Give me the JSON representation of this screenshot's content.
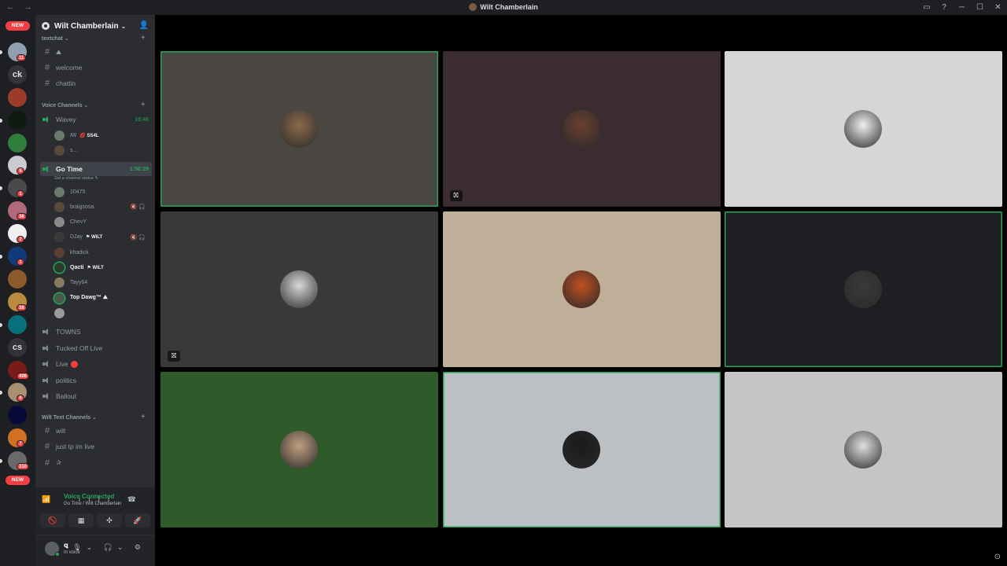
{
  "window": {
    "title": "Wilt Chamberlain",
    "nav_glyph": "← →",
    "controls": {
      "inbox": "▭",
      "help": "?",
      "minimize": "─",
      "maximize": "☐",
      "close": "✕"
    }
  },
  "guilds": {
    "items": [
      {
        "type": "new",
        "label": "NEW"
      },
      {
        "type": "icon",
        "color": "#8fa0b0",
        "badge": "11"
      },
      {
        "type": "text",
        "label": "ck"
      },
      {
        "type": "icon",
        "color": "#9a3b2b"
      },
      {
        "type": "icon",
        "color": "#0f1a12"
      },
      {
        "type": "icon",
        "color": "#2f7d3a"
      },
      {
        "type": "icon",
        "color": "#c9cbd0",
        "badge": "5"
      },
      {
        "type": "icon",
        "color": "#4a4a4a",
        "badge": "1"
      },
      {
        "type": "icon",
        "color": "#b06a7a",
        "badge": "38"
      },
      {
        "type": "icon",
        "color": "#f0f0f0",
        "badge": "2"
      },
      {
        "type": "icon",
        "color": "#123a7a",
        "badge": "1"
      },
      {
        "type": "icon",
        "color": "#8a5a2a"
      },
      {
        "type": "icon",
        "color": "#b98a40",
        "badge": "38"
      },
      {
        "type": "icon",
        "color": "#08707a"
      },
      {
        "type": "text",
        "label": "cs"
      },
      {
        "type": "icon",
        "color": "#7a1a1a",
        "badge": "406"
      },
      {
        "type": "icon",
        "color": "#a89070",
        "badge": "6"
      },
      {
        "type": "icon",
        "color": "#0a0a3a"
      },
      {
        "type": "icon",
        "color": "#d07020",
        "badge": "7"
      },
      {
        "type": "icon",
        "color": "#6a6a6a",
        "badge": "310"
      },
      {
        "type": "new",
        "label": "NEW"
      }
    ]
  },
  "server": {
    "name": "Wilt Chamberlain",
    "chevron": "⌄",
    "invite_icon": "👤",
    "categories": {
      "textchat": "textchat ⌄",
      "voice": "Voice Channels ⌄",
      "wilt_text": "Wilt Text Channels ⌄",
      "plus": "+"
    },
    "text_channels": [
      {
        "name": "⛰"
      },
      {
        "name": "welcome"
      },
      {
        "name": "chattin"
      }
    ],
    "voice_wavey": {
      "name": "Wavey",
      "timer": "16:46",
      "members": [
        {
          "name": "ꟿ",
          "tag": "💋 SS4L"
        },
        {
          "name": "s..."
        }
      ]
    },
    "voice_gotime": {
      "name": "Go Time",
      "timer": "1:56:29",
      "status": "Set a channel status ✎",
      "members": [
        {
          "name": "10475",
          "bold": false,
          "tag": "",
          "mute": ""
        },
        {
          "name": "braigsosa",
          "bold": false,
          "tag": "",
          "mute": "🔇🎧"
        },
        {
          "name": "ChevY",
          "bold": false,
          "tag": "",
          "mute": ""
        },
        {
          "name": "DJay",
          "bold": false,
          "tag": "⚑ WILT",
          "mute": "🔇🎧"
        },
        {
          "name": "khadick",
          "bold": false,
          "tag": "",
          "mute": ""
        },
        {
          "name": "Qacti",
          "bold": true,
          "tag": "⚑ WILT",
          "mute": ""
        },
        {
          "name": "Tayy64",
          "bold": false,
          "tag": "",
          "mute": ""
        },
        {
          "name": "Top Dawg™ ⛰",
          "bold": true,
          "tag": "",
          "mute": ""
        },
        {
          "name": "",
          "bold": false,
          "tag": "",
          "mute": ""
        }
      ]
    },
    "voice_more": [
      {
        "name": "TOWNS"
      },
      {
        "name": "Tucked Off Live"
      },
      {
        "name": "Live"
      },
      {
        "name": "politics"
      },
      {
        "name": "Ballout"
      }
    ],
    "wilt_channels": [
      {
        "name": "wilt"
      },
      {
        "name": "just tp im live"
      },
      {
        "name": "✰"
      }
    ]
  },
  "voice_status": {
    "title": "Voice Connected",
    "subtitle": "Go Time / Wilt Chamberlain",
    "signal_icon": "📶",
    "right_icons": "ıılı ☎",
    "buttons": [
      "🚫",
      "▦",
      "✣",
      "🚀"
    ]
  },
  "user_panel": {
    "name": "ꝗ",
    "status": "In voice",
    "controls": "🎙⌄ 🎧⌄ ⚙"
  },
  "stage": {
    "corner_icon": "⊙",
    "tiles": [
      {
        "bg": "#4a4743",
        "speaking": true,
        "avatar": "#8a6a4a",
        "cam": false
      },
      {
        "bg": "#3a2c30",
        "speaking": false,
        "avatar": "#6a4030",
        "cam": true
      },
      {
        "bg": "#d6d6d6",
        "speaking": false,
        "avatar": "#f0f0f0",
        "cam": false
      },
      {
        "bg": "#393939",
        "speaking": false,
        "avatar": "#d8d8d8",
        "cam": true
      },
      {
        "bg": "#bfae98",
        "speaking": false,
        "avatar": "#c05020",
        "cam": false
      },
      {
        "bg": "#1e1f22",
        "speaking": true,
        "avatar": "#3a3a3a",
        "cam": false
      },
      {
        "bg": "#2f5a2a",
        "speaking": false,
        "avatar": "#c0a080",
        "cam": false
      },
      {
        "bg": "#bcbfc3",
        "speaking": true,
        "avatar": "#1a1a1a",
        "cam": false
      },
      {
        "bg": "#c5c5c5",
        "speaking": false,
        "avatar": "#e0e0e0",
        "cam": false
      }
    ]
  },
  "accent": {
    "green": "#23a55a",
    "red": "#f23f43",
    "blurple": "#5865f2"
  }
}
